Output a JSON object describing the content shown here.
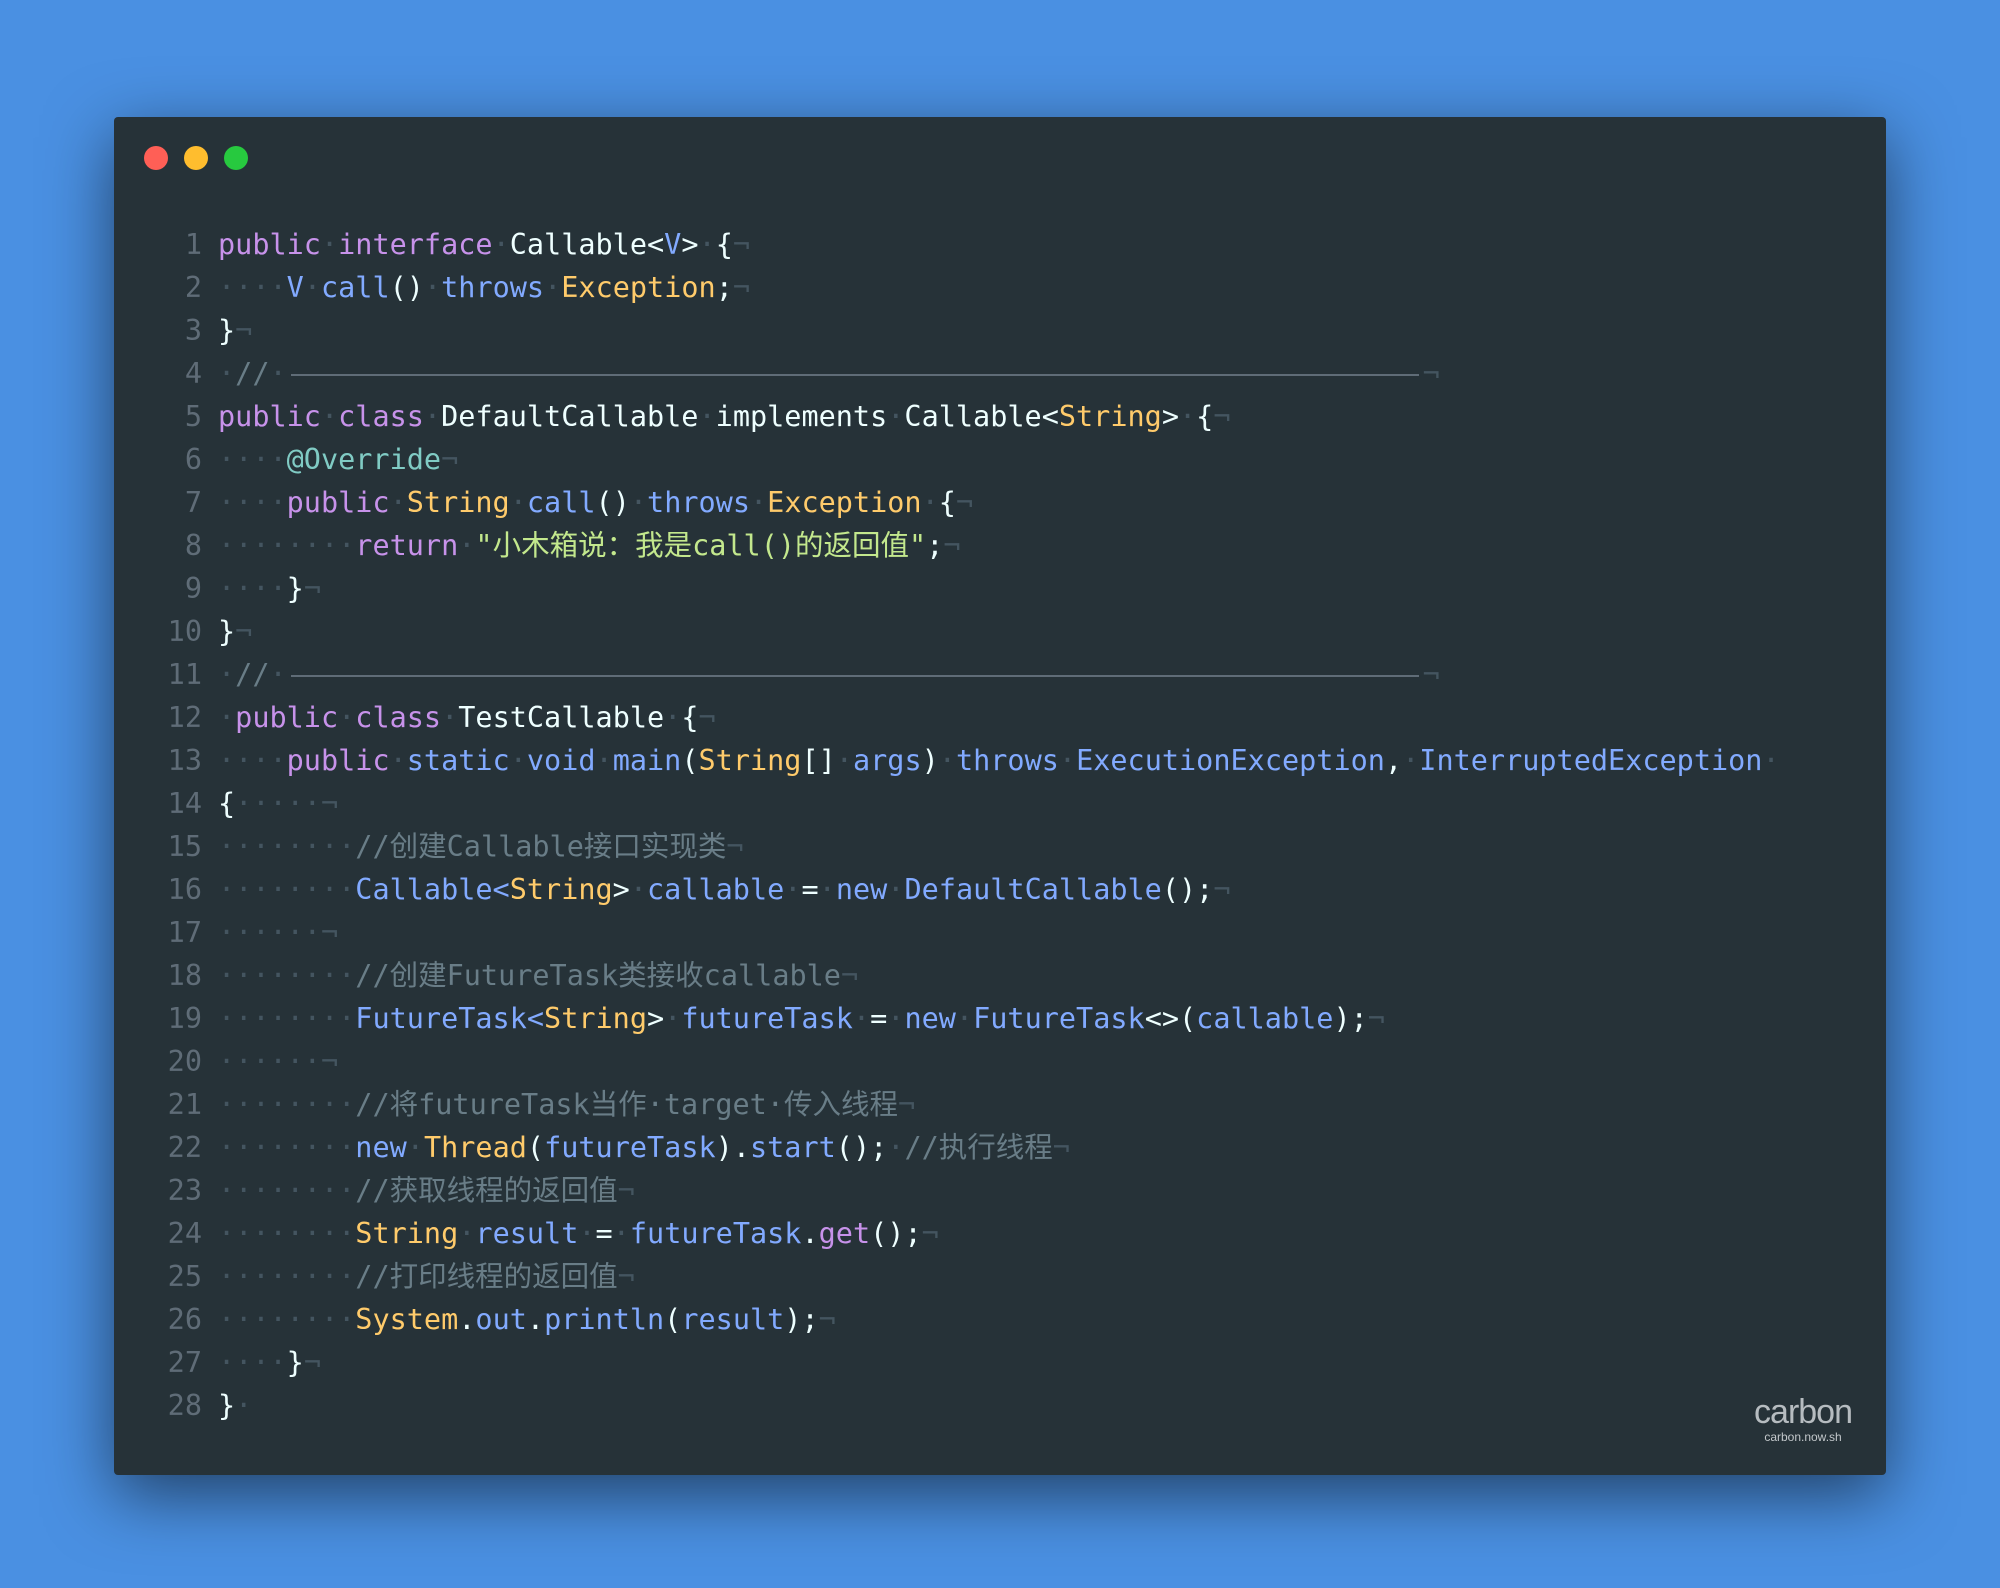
{
  "window": {
    "controls": [
      "close",
      "minimize",
      "maximize"
    ],
    "colors": {
      "close": "#ff5f56",
      "minimize": "#ffbd2e",
      "maximize": "#27c93f",
      "background": "#263238",
      "page": "#4a90e2"
    }
  },
  "code": {
    "language": "Java",
    "line_numbers": [
      "1",
      "2",
      "3",
      "4",
      "5",
      "6",
      "7",
      "8",
      "9",
      "10",
      "11",
      "12",
      "13",
      "14",
      "15",
      "16",
      "17",
      "18",
      "19",
      "20",
      "21",
      "22",
      "23",
      "24",
      "25",
      "26",
      "27",
      "28"
    ],
    "lines": [
      [
        [
          "kw",
          "public"
        ],
        [
          "ws",
          "·"
        ],
        [
          "kw",
          "interface"
        ],
        [
          "ws",
          "·"
        ],
        [
          "pn",
          "Callable<"
        ],
        [
          "ty",
          "V"
        ],
        [
          "pn",
          ">"
        ],
        [
          "ws",
          "·"
        ],
        [
          "pn",
          "{"
        ],
        [
          "ws",
          "¬"
        ]
      ],
      [
        [
          "ws",
          "····"
        ],
        [
          "ty",
          "V"
        ],
        [
          "ws",
          "·"
        ],
        [
          "fn",
          "call"
        ],
        [
          "pn",
          "()"
        ],
        [
          "ws",
          "·"
        ],
        [
          "ty",
          "throws"
        ],
        [
          "ws",
          "·"
        ],
        [
          "cl",
          "Exception"
        ],
        [
          "pn",
          ";"
        ],
        [
          "ws",
          "¬"
        ]
      ],
      [
        [
          "pn",
          "}"
        ],
        [
          "ws",
          "¬"
        ]
      ],
      [
        [
          "ws",
          "·"
        ],
        [
          "cm",
          "//"
        ],
        [
          "ws",
          "·"
        ],
        [
          "rule",
          ""
        ],
        [
          "ws",
          "¬"
        ]
      ],
      [
        [
          "kw",
          "public"
        ],
        [
          "ws",
          "·"
        ],
        [
          "kw",
          "class"
        ],
        [
          "ws",
          "·"
        ],
        [
          "pn",
          "DefaultCallable"
        ],
        [
          "ws",
          "·"
        ],
        [
          "pn",
          "implements"
        ],
        [
          "ws",
          "·"
        ],
        [
          "pn",
          "Callable<"
        ],
        [
          "cl",
          "String"
        ],
        [
          "pn",
          ">"
        ],
        [
          "ws",
          "·"
        ],
        [
          "pn",
          "{"
        ],
        [
          "ws",
          "¬"
        ]
      ],
      [
        [
          "ws",
          "····"
        ],
        [
          "an",
          "@Override"
        ],
        [
          "ws",
          "¬"
        ]
      ],
      [
        [
          "ws",
          "····"
        ],
        [
          "kw",
          "public"
        ],
        [
          "ws",
          "·"
        ],
        [
          "cl",
          "String"
        ],
        [
          "ws",
          "·"
        ],
        [
          "fn",
          "call"
        ],
        [
          "pn",
          "()"
        ],
        [
          "ws",
          "·"
        ],
        [
          "ty",
          "throws"
        ],
        [
          "ws",
          "·"
        ],
        [
          "cl",
          "Exception"
        ],
        [
          "ws",
          "·"
        ],
        [
          "pn",
          "{"
        ],
        [
          "ws",
          "¬"
        ]
      ],
      [
        [
          "ws",
          "········"
        ],
        [
          "kw",
          "return"
        ],
        [
          "ws",
          "·"
        ],
        [
          "st",
          "\"小木箱说：我是call()的返回值\""
        ],
        [
          "pn",
          ";"
        ],
        [
          "ws",
          "¬"
        ]
      ],
      [
        [
          "ws",
          "····"
        ],
        [
          "pn",
          "}"
        ],
        [
          "ws",
          "¬"
        ]
      ],
      [
        [
          "pn",
          "}"
        ],
        [
          "ws",
          "¬"
        ]
      ],
      [
        [
          "ws",
          "·"
        ],
        [
          "cm",
          "//"
        ],
        [
          "ws",
          "·"
        ],
        [
          "rule",
          ""
        ],
        [
          "ws",
          "¬"
        ]
      ],
      [
        [
          "ws",
          "·"
        ],
        [
          "kw",
          "public"
        ],
        [
          "ws",
          "·"
        ],
        [
          "kw",
          "class"
        ],
        [
          "ws",
          "·"
        ],
        [
          "pn",
          "TestCallable"
        ],
        [
          "ws",
          "·"
        ],
        [
          "pn",
          "{"
        ],
        [
          "ws",
          "¬"
        ]
      ],
      [
        [
          "ws",
          "····"
        ],
        [
          "kw",
          "public"
        ],
        [
          "ws",
          "·"
        ],
        [
          "ty",
          "static"
        ],
        [
          "ws",
          "·"
        ],
        [
          "ty",
          "void"
        ],
        [
          "ws",
          "·"
        ],
        [
          "fn",
          "main"
        ],
        [
          "pn",
          "("
        ],
        [
          "cl",
          "String"
        ],
        [
          "pn",
          "[]"
        ],
        [
          "ws",
          "·"
        ],
        [
          "ty",
          "args"
        ],
        [
          "pn",
          ")"
        ],
        [
          "ws",
          "·"
        ],
        [
          "ty",
          "throws"
        ],
        [
          "ws",
          "·"
        ],
        [
          "ty",
          "ExecutionException"
        ],
        [
          "pn",
          ","
        ],
        [
          "ws",
          "·"
        ],
        [
          "ty",
          "InterruptedException"
        ],
        [
          "ws",
          "·"
        ]
      ],
      [
        [
          "pn",
          "{"
        ],
        [
          "ws",
          "·····¬"
        ]
      ],
      [
        [
          "ws",
          "········"
        ],
        [
          "cm",
          "//创建Callable接口实现类"
        ],
        [
          "ws",
          "¬"
        ]
      ],
      [
        [
          "ws",
          "········"
        ],
        [
          "ty",
          "Callable<"
        ],
        [
          "cl",
          "String"
        ],
        [
          "pn",
          ">"
        ],
        [
          "ws",
          "·"
        ],
        [
          "ty",
          "callable"
        ],
        [
          "ws",
          "·"
        ],
        [
          "pn",
          "="
        ],
        [
          "ws",
          "·"
        ],
        [
          "ty",
          "new"
        ],
        [
          "ws",
          "·"
        ],
        [
          "ty",
          "DefaultCallable"
        ],
        [
          "pn",
          "();"
        ],
        [
          "ws",
          "¬"
        ]
      ],
      [
        [
          "ws",
          "······¬"
        ]
      ],
      [
        [
          "ws",
          "········"
        ],
        [
          "cm",
          "//创建FutureTask类接收callable"
        ],
        [
          "ws",
          "¬"
        ]
      ],
      [
        [
          "ws",
          "········"
        ],
        [
          "ty",
          "FutureTask<"
        ],
        [
          "cl",
          "String"
        ],
        [
          "pn",
          ">"
        ],
        [
          "ws",
          "·"
        ],
        [
          "ty",
          "futureTask"
        ],
        [
          "ws",
          "·"
        ],
        [
          "pn",
          "="
        ],
        [
          "ws",
          "·"
        ],
        [
          "ty",
          "new"
        ],
        [
          "ws",
          "·"
        ],
        [
          "ty",
          "FutureTask"
        ],
        [
          "pn",
          "<>("
        ],
        [
          "ty",
          "callable"
        ],
        [
          "pn",
          ");"
        ],
        [
          "ws",
          "¬"
        ]
      ],
      [
        [
          "ws",
          "······¬"
        ]
      ],
      [
        [
          "ws",
          "········"
        ],
        [
          "cm",
          "//将futureTask当作·target·传入线程"
        ],
        [
          "ws",
          "¬"
        ]
      ],
      [
        [
          "ws",
          "········"
        ],
        [
          "ty",
          "new"
        ],
        [
          "ws",
          "·"
        ],
        [
          "cl",
          "Thread"
        ],
        [
          "pn",
          "("
        ],
        [
          "ty",
          "futureTask"
        ],
        [
          "pn",
          ")."
        ],
        [
          "fn",
          "start"
        ],
        [
          "pn",
          "();"
        ],
        [
          "ws",
          "·"
        ],
        [
          "cm",
          "//执行线程"
        ],
        [
          "ws",
          "¬"
        ]
      ],
      [
        [
          "ws",
          "········"
        ],
        [
          "cm",
          "//获取线程的返回值"
        ],
        [
          "ws",
          "¬"
        ]
      ],
      [
        [
          "ws",
          "········"
        ],
        [
          "cl",
          "String"
        ],
        [
          "ws",
          "·"
        ],
        [
          "ty",
          "result"
        ],
        [
          "ws",
          "·"
        ],
        [
          "pn",
          "="
        ],
        [
          "ws",
          "·"
        ],
        [
          "ty",
          "futureTask"
        ],
        [
          "pn",
          "."
        ],
        [
          "kw",
          "get"
        ],
        [
          "pn",
          "();"
        ],
        [
          "ws",
          "¬"
        ]
      ],
      [
        [
          "ws",
          "········"
        ],
        [
          "cm",
          "//打印线程的返回值"
        ],
        [
          "ws",
          "¬"
        ]
      ],
      [
        [
          "ws",
          "········"
        ],
        [
          "cl",
          "System"
        ],
        [
          "pn",
          "."
        ],
        [
          "ty",
          "out"
        ],
        [
          "pn",
          "."
        ],
        [
          "fn",
          "println"
        ],
        [
          "pn",
          "("
        ],
        [
          "ty",
          "result"
        ],
        [
          "pn",
          ");"
        ],
        [
          "ws",
          "¬"
        ]
      ],
      [
        [
          "ws",
          "····"
        ],
        [
          "pn",
          "}"
        ],
        [
          "ws",
          "¬"
        ]
      ],
      [
        [
          "pn",
          "}"
        ],
        [
          "ws",
          "·"
        ]
      ]
    ]
  },
  "branding": {
    "logo": "carbon",
    "url": "carbon.now.sh"
  }
}
